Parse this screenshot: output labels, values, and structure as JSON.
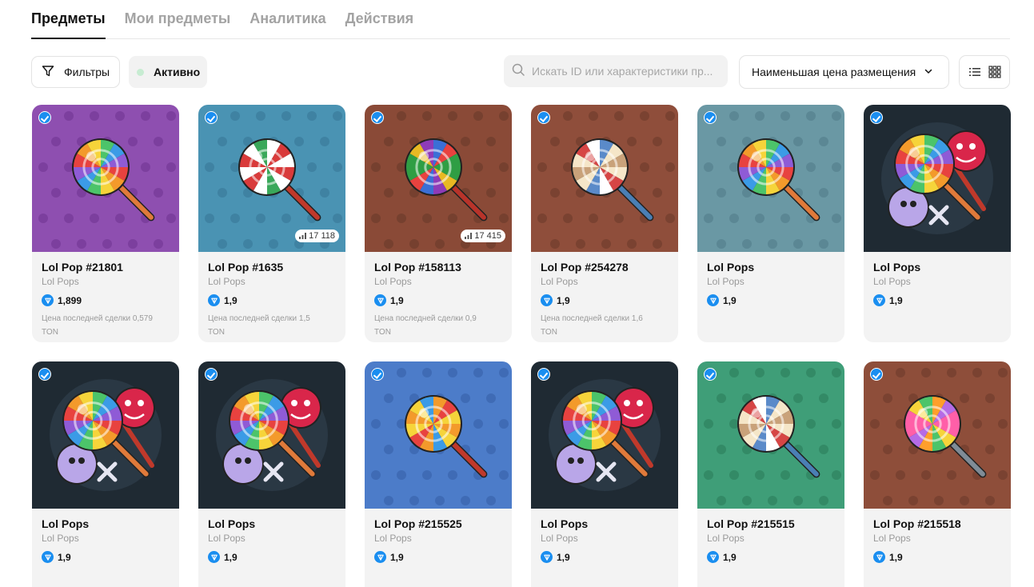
{
  "tabs": [
    {
      "label": "Предметы",
      "active": true
    },
    {
      "label": "Мои предметы",
      "active": false
    },
    {
      "label": "Аналитика",
      "active": false
    },
    {
      "label": "Действия",
      "active": false
    }
  ],
  "toolbar": {
    "filter_label": "Фильтры",
    "status_label": "Активно",
    "search_placeholder": "Искать ID или характеристики пр...",
    "sort_label": "Наименьшая цена размещения",
    "filter_icon": "filter-icon",
    "search_icon": "search-icon",
    "sort_icon": "chevron-down-icon",
    "view_list_icon": "list-view-icon",
    "view_grid_icon": "grid-view-icon",
    "status_dot_color": "#c7ecd2"
  },
  "colors": {
    "accent": "#1a8ef0",
    "card_bg": "#f3f3f3"
  },
  "cards": [
    {
      "title": "Lol Pop #21801",
      "collection": "Lol Pops",
      "price": "1,899",
      "last_sale": "Цена последней сделки 0,579 TON",
      "stats": "",
      "bg": "#8e4fb0",
      "pattern": "#7c3f9e",
      "candy": "rainbow",
      "stick": "#e07a3a",
      "variant": "single"
    },
    {
      "title": "Lol Pop #1635",
      "collection": "Lol Pops",
      "price": "1,9",
      "last_sale": "Цена последней сделки 1,5 TON",
      "stats": "17 118",
      "bg": "#4a93b3",
      "pattern": "#3f82a2",
      "candy": "xmas",
      "stick": "#c0392b",
      "variant": "single"
    },
    {
      "title": "Lol Pop #158113",
      "collection": "Lol Pops",
      "price": "1,9",
      "last_sale": "Цена последней сделки 0,9 TON",
      "stats": "17 415",
      "bg": "#8a4a37",
      "pattern": "#76402f",
      "candy": "dark",
      "stick": "#b8332a",
      "variant": "single"
    },
    {
      "title": "Lol Pop #254278",
      "collection": "Lol Pops",
      "price": "1,9",
      "last_sale": "Цена последней сделки 1,6 TON",
      "stats": "",
      "bg": "#8f4e3b",
      "pattern": "#7a4231",
      "candy": "cream",
      "stick": "#4a7fb5",
      "variant": "single"
    },
    {
      "title": "Lol Pops",
      "collection": "Lol Pops",
      "price": "1,9",
      "last_sale": "",
      "stats": "",
      "bg": "#6a98a4",
      "pattern": "#5b8794",
      "candy": "rainbow",
      "stick": "#e07a3a",
      "variant": "single"
    },
    {
      "title": "Lol Pops",
      "collection": "Lol Pops",
      "price": "1,9",
      "last_sale": "",
      "stats": "",
      "bg": "#1f2a33",
      "pattern": "#1f2a33",
      "candy": "rainbow",
      "stick": "#e07a3a",
      "variant": "combo"
    },
    {
      "title": "Lol Pops",
      "collection": "Lol Pops",
      "price": "1,9",
      "last_sale": "",
      "stats": "",
      "bg": "#1f2a33",
      "pattern": "#1f2a33",
      "candy": "rainbow",
      "stick": "#e07a3a",
      "variant": "combo"
    },
    {
      "title": "Lol Pops",
      "collection": "Lol Pops",
      "price": "1,9",
      "last_sale": "",
      "stats": "",
      "bg": "#1f2a33",
      "pattern": "#1f2a33",
      "candy": "rainbow",
      "stick": "#e07a3a",
      "variant": "combo"
    },
    {
      "title": "Lol Pop #215525",
      "collection": "Lol Pops",
      "price": "1,9",
      "last_sale": "",
      "stats": "",
      "bg": "#4c7cc9",
      "pattern": "#3f6bb5",
      "candy": "sunset",
      "stick": "#c0392b",
      "variant": "single"
    },
    {
      "title": "Lol Pops",
      "collection": "Lol Pops",
      "price": "1,9",
      "last_sale": "",
      "stats": "",
      "bg": "#1f2a33",
      "pattern": "#1f2a33",
      "candy": "rainbow",
      "stick": "#e07a3a",
      "variant": "combo"
    },
    {
      "title": "Lol Pop #215515",
      "collection": "Lol Pops",
      "price": "1,9",
      "last_sale": "",
      "stats": "",
      "bg": "#3f9e78",
      "pattern": "#338a66",
      "candy": "cream",
      "stick": "#4a7fb5",
      "variant": "single"
    },
    {
      "title": "Lol Pop #215518",
      "collection": "Lol Pops",
      "price": "1,9",
      "last_sale": "",
      "stats": "",
      "bg": "#8e4e3a",
      "pattern": "#7a4231",
      "candy": "pink",
      "stick": "#7f8c97",
      "variant": "single"
    }
  ]
}
